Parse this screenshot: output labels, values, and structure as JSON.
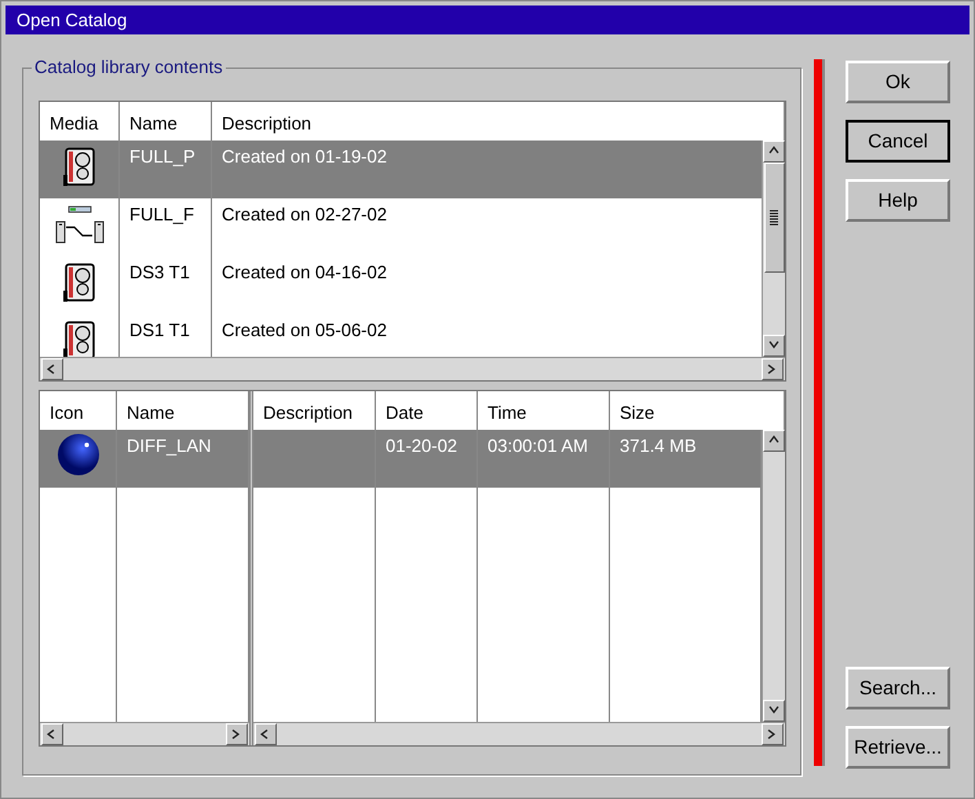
{
  "window": {
    "title": "Open Catalog"
  },
  "group": {
    "label": "Catalog library contents"
  },
  "catalog_table": {
    "columns": [
      "Media",
      "Name",
      "Description"
    ],
    "rows": [
      {
        "kind": "tape",
        "name": "FULL_P",
        "description": "Created on 01-19-02",
        "selected": true
      },
      {
        "kind": "drives",
        "name": "FULL_F",
        "description": "Created on 02-27-02",
        "selected": false
      },
      {
        "kind": "tape",
        "name": "DS3 T1",
        "description": "Created on 04-16-02",
        "selected": false
      },
      {
        "kind": "tape",
        "name": "DS1 T1",
        "description": "Created on 05-06-02",
        "selected": false
      }
    ]
  },
  "files_table": {
    "left_columns": [
      "Icon",
      "Name"
    ],
    "right_columns": [
      "Description",
      "Date",
      "Time",
      "Size"
    ],
    "rows": [
      {
        "kind": "globe",
        "name": "DIFF_LAN",
        "description": "",
        "date": "01-20-02",
        "time": "03:00:01 AM",
        "size": "371.4 MB",
        "selected": true
      }
    ]
  },
  "buttons": [
    {
      "label": "Ok",
      "default": false
    },
    {
      "label": "Cancel",
      "default": true
    },
    {
      "label": "Help",
      "default": false
    }
  ],
  "bottom_buttons": [
    {
      "label": "Search..."
    },
    {
      "label": "Retrieve..."
    }
  ]
}
